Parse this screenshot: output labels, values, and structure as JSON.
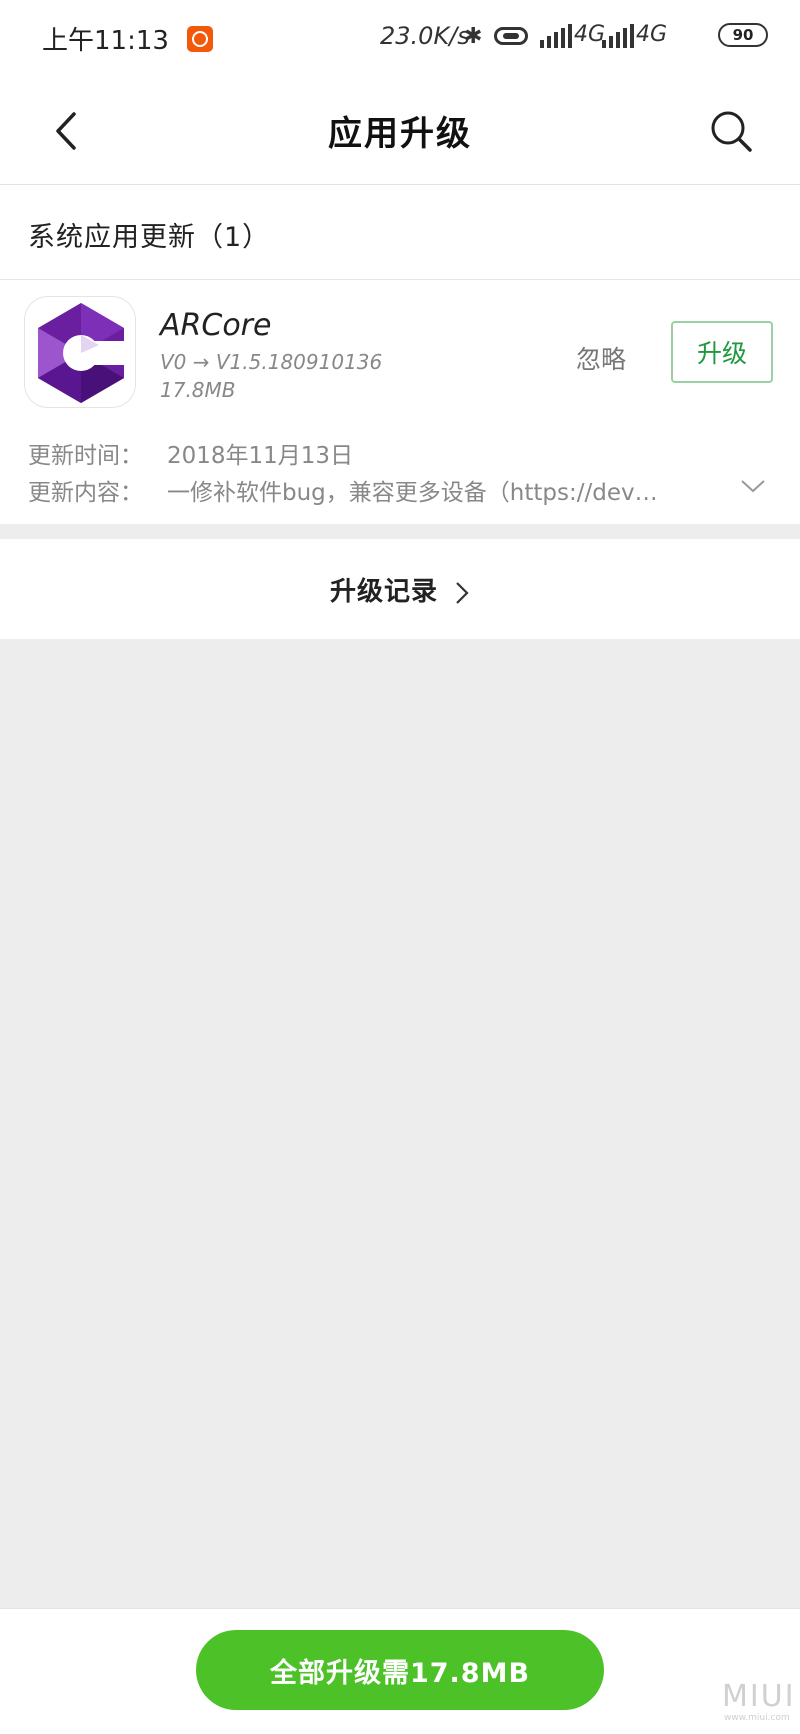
{
  "status_bar": {
    "time": "上午11:13",
    "net_speed": "23.0K/s",
    "network_1": "4G",
    "network_2": "4G",
    "battery": "90"
  },
  "navbar": {
    "title": "应用升级",
    "back_icon": "back-chevron-icon",
    "search_icon": "search-icon"
  },
  "section": {
    "title": "系统应用更新（1）"
  },
  "app": {
    "name": "ARCore",
    "version": "V0 → V1.5.180910136",
    "size": "17.8MB",
    "ignore_label": "忽略",
    "upgrade_label": "升级",
    "update_time_label": "更新时间：",
    "update_time": "2018年11月13日",
    "update_content_label": "更新内容：",
    "update_content": "一修补软件bug，兼容更多设备（https://dev…",
    "icon_colors": [
      "#6a1fa1",
      "#8e3ec4",
      "#b98ad8"
    ]
  },
  "history": {
    "label": "升级记录"
  },
  "bottom": {
    "upgrade_all_label": "全部升级需17.8MB",
    "accent": "#4cc228"
  },
  "watermark": {
    "brand": "MIUI",
    "url": "www.miui.com"
  }
}
